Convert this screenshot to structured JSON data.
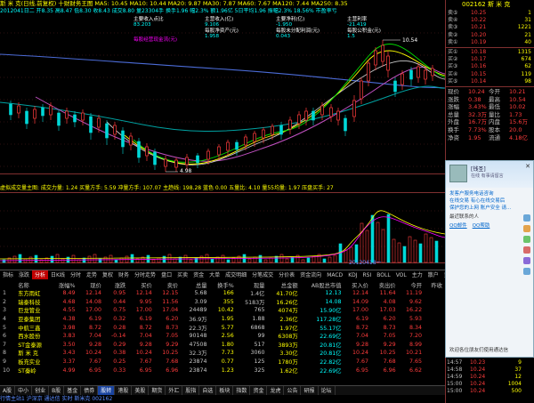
{
  "title": "斯 米 克(日线,前复权)  十财财务王图  MA5: 10.45  MA10: 10.44  MA20: 9.87  MA30: 7.87  MA60: 7.67  MA120: 7.44  MA250: 8.35",
  "info_line": "2012041日二  开8.35 高8.47 低8.30 收8.43 成交8.80 量23304手 换手1.96 幅2.3% 额1.96亿 5日平均1.96 振幅2.3% 18.56% 市盈率亏",
  "annotations": [
    {
      "label": "主要收入点比",
      "value": "83.203"
    },
    {
      "label": "主营收入(亿)",
      "value": "9.106"
    },
    {
      "label": "主要净利(亿)",
      "value": "-1.950"
    },
    {
      "label": "主营利率",
      "value": "-21.419"
    },
    {
      "label": "每股经营现金流(元)",
      "value": "0.154"
    },
    {
      "label": "每股净资产(元)",
      "value": "1.958"
    },
    {
      "label": "每股未分配利润(元)",
      "value": "0.043"
    },
    {
      "label": "每股公积金(元)",
      "value": "1.5"
    }
  ],
  "price_tags": {
    "high": "10.54",
    "low": "4.98"
  },
  "indicator_line": "虚拟成交量主图: 成交力量: 1.24  买量方手: 5.59  冲量方手: 107.07  主趋线: 198.28  蓝色 0.00  五量比: 4.10  量55均量: 1.97  压盘买手: 27",
  "date_label": "20120418一",
  "tabs": [
    "指标",
    "涨跌",
    "分析",
    "日K线",
    "分时",
    "走势",
    "复权",
    "财务",
    "分时走势",
    "盘口",
    "买卖",
    "资金",
    "大单",
    "成交明细",
    "分笔成交",
    "分价表",
    "资金流向",
    "MACD",
    "KDJ",
    "RSI",
    "BOLL",
    "VOL",
    "主力",
    "散户",
    "资金",
    "增减",
    "涨停",
    "跌停",
    "市场",
    "行业",
    "MACL"
  ],
  "active_tab": "分析",
  "table": {
    "headers": [
      "",
      "名称",
      "涨幅%",
      "现价",
      "涨跌",
      "买价",
      "卖价",
      "总量",
      "换手%",
      "现量",
      "总金额",
      "AB股总市值",
      "买入价",
      "卖出价",
      "今开",
      "昨收"
    ],
    "rows": [
      [
        "1",
        "东方雨虹",
        "8.49",
        "12.14",
        "0.95",
        "12.14",
        "12.15",
        "5.68",
        "166",
        "1.4亿",
        "41.70亿",
        "12.13",
        "12.14",
        "11.64",
        "11.19"
      ],
      [
        "2",
        "瑞泰科技",
        "4.68",
        "14.08",
        "0.44",
        "9.95",
        "11.56",
        "3.09",
        "355",
        "5183万",
        "16.26亿",
        "14.08",
        "14.09",
        "4.08",
        "9.62"
      ],
      [
        "3",
        "巨龙管业",
        "4.55",
        "17.00",
        "0.75",
        "17.00",
        "17.04",
        "24489",
        "10.42",
        "765",
        "4074万",
        "15.90亿",
        "17.00",
        "17.03",
        "16.22"
      ],
      [
        "4",
        "亚泰集团",
        "4.38",
        "6.19",
        "0.32",
        "6.19",
        "6.20",
        "36.9万",
        "1.95",
        "1.88",
        "2.36亿",
        "117.28亿",
        "6.19",
        "6.20",
        "5.93"
      ],
      [
        "5",
        "中航三鑫",
        "3.98",
        "8.72",
        "0.28",
        "8.72",
        "8.73",
        "22.3万",
        "5.77",
        "6868",
        "1.97亿",
        "55.17亿",
        "8.72",
        "8.73",
        "8.34"
      ],
      [
        "6",
        "西水股份",
        "3.83",
        "7.04",
        "-0.14",
        "7.04",
        "7.05",
        "90148",
        "2.56",
        "99",
        "6308万",
        "22.69亿",
        "7.04",
        "7.05",
        "7.20"
      ],
      [
        "7",
        "ST金泰源",
        "3.50",
        "9.28",
        "0.29",
        "9.28",
        "9.29",
        "47508",
        "1.80",
        "517",
        "3893万",
        "20.81亿",
        "9.28",
        "9.29",
        "8.99"
      ],
      [
        "8",
        "斯 米 克",
        "3.43",
        "10.24",
        "0.38",
        "10.24",
        "10.25",
        "32.3万",
        "7.73",
        "3060",
        "3.30亿",
        "20.81亿",
        "10.24",
        "10.25",
        "10.21"
      ],
      [
        "9",
        "板充实业",
        "3.37",
        "7.67",
        "0.25",
        "7.67",
        "7.68",
        "23874",
        "0.77",
        "125",
        "1780万",
        "22.82亿",
        "7.67",
        "7.68",
        "7.65"
      ],
      [
        "10",
        "ST秦岭",
        "4.99",
        "6.95",
        "0.33",
        "6.95",
        "6.96",
        "23874",
        "1.23",
        "325",
        "1.62亿",
        "22.69亿",
        "6.95",
        "6.96",
        "6.62"
      ]
    ]
  },
  "bottom_tabs": [
    "A股",
    "中小",
    "创业",
    "B股",
    "基金",
    "债券",
    "股转",
    "港股",
    "美股",
    "期货",
    "外汇",
    "股指",
    "自选",
    "板块",
    "指数",
    "资金",
    "龙虎",
    "公告",
    "研报",
    "论坛"
  ],
  "active_bottom_tab": "股转",
  "status_text": "行情主站1 沪深京  通达信 实时 斯米克 002162",
  "right_panel": {
    "code_name": "002162 斯 米 克",
    "sell_rows": [
      [
        "卖⑤",
        "10.25",
        "1"
      ],
      [
        "卖④",
        "10.22",
        "31"
      ],
      [
        "卖③",
        "10.21",
        "1221"
      ],
      [
        "卖②",
        "10.20",
        "21"
      ],
      [
        "卖①",
        "10.19",
        "40"
      ]
    ],
    "buy_rows": [
      [
        "买①",
        "10.18",
        "1315"
      ],
      [
        "买②",
        "10.17",
        "674"
      ],
      [
        "买③",
        "10.16",
        "62"
      ],
      [
        "买④",
        "10.15",
        "119"
      ],
      [
        "买⑤",
        "10.14",
        "98"
      ]
    ],
    "stats": [
      [
        "现价",
        "10.24",
        "今开",
        "10.21"
      ],
      [
        "涨跌",
        "0.38",
        "最高",
        "10.54"
      ],
      [
        "涨幅",
        "3.43%",
        "最低",
        "10.02"
      ],
      [
        "总量",
        "32.3万",
        "量比",
        "1.73"
      ],
      [
        "外盘",
        "16.7万",
        "内盘",
        "15.6万"
      ],
      [
        "换手",
        "7.73%",
        "股本",
        "20.0"
      ],
      [
        "净资",
        "1.95",
        "流通",
        "4.18亿"
      ]
    ]
  },
  "chat": {
    "title": "[钱圣]",
    "subtitle": "在线 有事请留言",
    "lines": [
      "发客户服务电话咨询",
      "在线交易 有心在线交易后",
      "保护您的上网 账户安全 请...",
      "最近联系的人"
    ],
    "links": [
      "QQ邮件",
      "QQ帮助"
    ],
    "footer": "欢迎各位朋友们使用通达信"
  },
  "ticks": [
    [
      "14:57",
      "10.23",
      "9"
    ],
    [
      "14:58",
      "10.24",
      "37"
    ],
    [
      "14:59",
      "10.24",
      "12"
    ],
    [
      "15:00",
      "10.24",
      "1004"
    ],
    [
      "15:00",
      "10.24",
      "500"
    ]
  ]
}
